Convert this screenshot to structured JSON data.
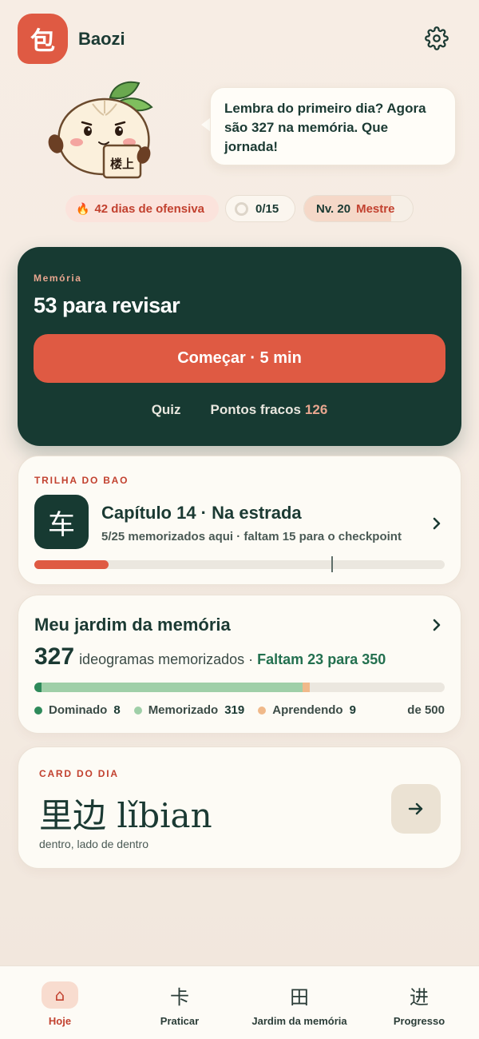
{
  "header": {
    "logo_char": "包",
    "app_name": "Baozi",
    "settings_icon": "gear-icon"
  },
  "mascot": {
    "sign_text": "楼上",
    "speech": "Lembra do primeiro dia? Agora são 327 na memória. Que jornada!"
  },
  "stats": {
    "streak_icon": "🔥",
    "streak_label": "42 dias de ofensiva",
    "daily_goal_label": "0/15",
    "daily_goal_progress": 0,
    "level_label": "Nv. 20",
    "level_rank": "Mestre",
    "level_progress": 0.8
  },
  "review": {
    "eyebrow": "Memória",
    "title": "53 para revisar",
    "start_label": "Começar · 5 min",
    "quiz_label": "Quiz",
    "weak_points_label": "Pontos fracos",
    "weak_points_count": "126"
  },
  "trail": {
    "eyebrow": "TRILHA DO BAO",
    "chapter_char": "车",
    "chapter_title": "Capítulo 14 · Na estrada",
    "chapter_subtitle": "5/25 memorizados aqui · faltam 15 para o checkpoint",
    "progress_memorized": 5,
    "checkpoint_at": 20,
    "chapter_total": 25
  },
  "garden": {
    "title": "Meu jardim da memória",
    "count": "327",
    "count_unit": "ideogramas memorizados",
    "separator": "·",
    "goal_text": "Faltam 23 para 350",
    "segments": [
      {
        "name": "Dominado",
        "value": 8,
        "color": "#2e8a5a"
      },
      {
        "name": "Memorizado",
        "value": 319,
        "color": "#9fcfa8"
      },
      {
        "name": "Aprendendo",
        "value": 9,
        "color": "#f0b98a"
      }
    ],
    "total": 500,
    "total_label": "de 500"
  },
  "daily_card": {
    "eyebrow": "CARD DO DIA",
    "hanzi": "里边",
    "pinyin": "lǐbian",
    "meaning": "dentro, lado de dentro"
  },
  "nav": {
    "items": [
      {
        "label": "Hoje",
        "icon": "⌂",
        "icon_name": "home-icon",
        "active": true
      },
      {
        "label": "Praticar",
        "icon": "卡",
        "icon_name": "practice-card-icon",
        "active": false
      },
      {
        "label": "Jardim da memória",
        "icon": "田",
        "icon_name": "garden-field-icon",
        "active": false
      },
      {
        "label": "Progresso",
        "icon": "进",
        "icon_name": "progress-icon",
        "active": false
      }
    ]
  }
}
